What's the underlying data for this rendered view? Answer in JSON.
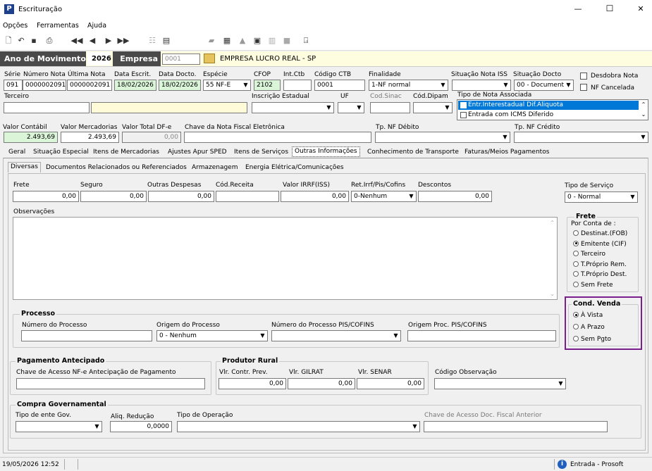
{
  "window": {
    "title": "Escrituração",
    "app_icon": "P",
    "minimize": "—",
    "maximize": "☐",
    "close": "✕"
  },
  "menu": [
    "Opções",
    "Ferramentas",
    "Ajuda"
  ],
  "toolbar_icons": [
    "new-doc-icon",
    "undo-icon",
    "save-icon",
    "print-preview-icon",
    "first-record-icon",
    "prev-record-icon",
    "next-record-icon",
    "last-record-icon",
    "tree-icon",
    "report-icon",
    "truck-icon",
    "calculator-icon",
    "factory-icon",
    "building-icon",
    "book-icon",
    "box-icon",
    "exit-icon"
  ],
  "header": {
    "ano_label": "Ano de Movimento",
    "ano_value": "2026",
    "empresa_label": "Empresa",
    "empresa_code": "0001",
    "empresa_name": "EMPRESA LUCRO REAL - SP"
  },
  "row1": {
    "serie_l": "Série",
    "serie": "091",
    "numnota_l": "Número Nota",
    "numnota": "0000002091",
    "ultnota_l": "Última Nota",
    "ultnota": "0000002091",
    "dataescrit_l": "Data Escrit.",
    "dataescrit": "18/02/2026",
    "datadocto_l": "Data Docto.",
    "datadocto": "18/02/2026",
    "especie_l": "Espécie",
    "especie_num": "55",
    "especie": "NF-E",
    "cfop_l": "CFOP",
    "cfop": "2102",
    "intctb_l": "Int.Ctb",
    "intctb": "",
    "codctb_l": "Código CTB",
    "codctb": "0001",
    "finalidade_l": "Finalidade",
    "finalidade": "1-NF normal",
    "sitiss_l": "Situação Nota ISS",
    "sitiss": "",
    "sitdocto_l": "Situação Docto",
    "sitdocto": "00 - Document",
    "desdobra": "Desdobra Nota",
    "nfcancelada": "NF Cancelada"
  },
  "row2": {
    "terceiro_l": "Terceiro",
    "inscest_l": "Inscrição Estadual",
    "uf_l": "UF",
    "codsinac_l": "Cod.Sinac",
    "coddipam_l": "Cód.Dipam",
    "tiponota_l": "Tipo de Nota Associada",
    "tiponota_opts": [
      "Entr.Interestadual Dif.Aliquota",
      "Entrada com ICMS Diferido"
    ]
  },
  "row3": {
    "vlcontabil_l": "Valor Contábil",
    "vlcontabil": "2.493,69",
    "vlmerc_l": "Valor Mercadorias",
    "vlmerc": "2.493,69",
    "vltotdfe_l": "Valor Total DF-e",
    "vltotdfe": "0,00",
    "chave_l": "Chave da Nota Fiscal Eletrônica",
    "tpdebito_l": "Tp. NF Débito",
    "tpcredito_l": "Tp. NF Crédito"
  },
  "tabs": [
    "Geral",
    "Situação Especial",
    "Itens de Mercadorias",
    "Ajustes Apur SPED",
    "Itens de Serviços",
    "Outras Informações",
    "Conhecimento de Transporte",
    "Faturas/Meios Pagamentos"
  ],
  "subtabs": [
    "Diversas",
    "Documentos Relacionados ou Referenciados",
    "Armazenagem",
    "Energia Elétrica/Comunicações"
  ],
  "diversas": {
    "frete_l": "Frete",
    "frete": "0,00",
    "seguro_l": "Seguro",
    "seguro": "0,00",
    "outras_l": "Outras Despesas",
    "outras": "0,00",
    "codrec_l": "Cód.Receita",
    "codrec": "",
    "irrf_l": "Valor IRRF(ISS)",
    "irrf": "0,00",
    "ret_l": "Ret.Irrf/Pis/Cofins",
    "ret": "0-Nenhum",
    "desc_l": "Descontos",
    "desc": "0,00",
    "tiposerv_l": "Tipo de Serviço",
    "tiposerv": "0 - Normal",
    "obs_l": "Observações",
    "obs": ""
  },
  "frete_grp": {
    "title": "Frete",
    "por_conta": "Por Conta de :",
    "opts": [
      "Destinat.(FOB)",
      "Emitente (CIF)",
      "Terceiro",
      "T.Próprio Rem.",
      "T.Próprio Dest.",
      "Sem Frete"
    ],
    "selected": 1
  },
  "cond_venda": {
    "title": "Cond. Venda",
    "opts": [
      "À Vista",
      "A Prazo",
      "Sem Pgto"
    ],
    "selected": 0,
    "border_color": "#7b1f8f"
  },
  "processo": {
    "title": "Processo",
    "num_l": "Número do Processo",
    "num": "",
    "origem_l": "Origem do Processo",
    "origem": "0 - Nenhum",
    "numpis_l": "Número do Processo PIS/COFINS",
    "numpis": "",
    "origpis_l": "Origem Proc. PIS/COFINS",
    "origpis": ""
  },
  "pag_antecipado": {
    "title": "Pagamento Antecipado",
    "chave_l": "Chave de Acesso NF-e Antecipação de Pagamento",
    "chave": ""
  },
  "produtor": {
    "title": "Produtor Rural",
    "prev_l": "Vlr. Contr. Prev.",
    "prev": "0,00",
    "gilrat_l": "Vlr. GILRAT",
    "gilrat": "0,00",
    "senar_l": "Vlr. SENAR",
    "senar": "0,00"
  },
  "codobs_l": "Código Observação",
  "compra_gov": {
    "title": "Compra Governamental",
    "tipoente_l": "Tipo de ente Gov.",
    "aliq_l": "Aliq. Redução",
    "aliq": "0,0000",
    "tipoop_l": "Tipo de Operação",
    "chaveant_l": "Chave de Acesso Doc. Fiscal Anterior"
  },
  "status": {
    "datetime": "19/05/2026  12:52",
    "info_icon": "i",
    "mode": "Entrada - Prosoft"
  }
}
